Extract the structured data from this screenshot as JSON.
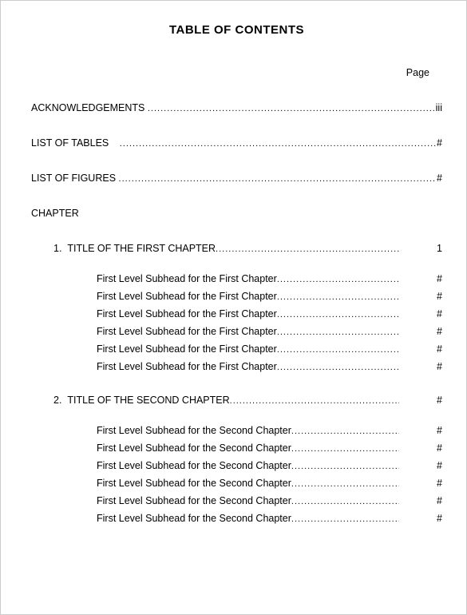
{
  "title": "TABLE OF CONTENTS",
  "page_label": "Page",
  "front_matter": [
    {
      "label": "ACKNOWLEDGEMENTS",
      "page": "iii",
      "leader_gap": false
    },
    {
      "label": "LIST OF TABLES",
      "page": "#",
      "leader_gap": true
    },
    {
      "label": "LIST OF FIGURES",
      "page": "#",
      "leader_gap": false
    }
  ],
  "chapter_heading": "CHAPTER",
  "chapters": [
    {
      "num": "1.",
      "title": "TITLE OF THE FIRST CHAPTER",
      "page": "1",
      "subheads": [
        {
          "label": "First Level Subhead for the First Chapter",
          "page": "#"
        },
        {
          "label": "First Level Subhead for the First Chapter",
          "page": "#"
        },
        {
          "label": "First Level Subhead for the First Chapter",
          "page": "#"
        },
        {
          "label": "First Level Subhead for the First Chapter",
          "page": "#"
        },
        {
          "label": "First Level Subhead for the First Chapter",
          "page": "#"
        },
        {
          "label": "First Level Subhead for the First Chapter",
          "page": "#"
        }
      ]
    },
    {
      "num": "2.",
      "title": "TITLE OF THE SECOND CHAPTER",
      "page": "#",
      "subheads": [
        {
          "label": "First Level Subhead for the Second Chapter",
          "page": "#"
        },
        {
          "label": "First Level Subhead for the Second Chapter",
          "page": "#"
        },
        {
          "label": "First Level Subhead for the Second Chapter",
          "page": "#"
        },
        {
          "label": "First Level Subhead for the Second Chapter",
          "page": "#"
        },
        {
          "label": "First Level Subhead for the Second Chapter",
          "page": "#"
        },
        {
          "label": "First Level Subhead for the Second Chapter",
          "page": "#"
        }
      ]
    }
  ]
}
